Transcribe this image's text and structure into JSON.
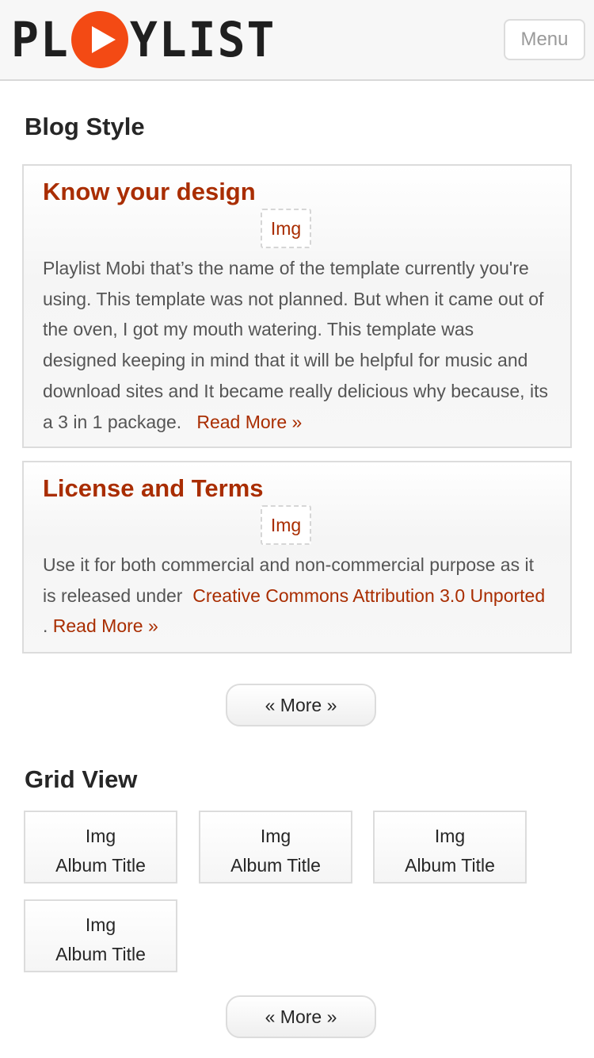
{
  "header": {
    "logo": {
      "left": "PL",
      "right": "YLIST",
      "icon": "play-circle-icon"
    },
    "menu_label": "Menu"
  },
  "colors": {
    "accent": "#a92d00",
    "logo_orange": "#f34a14",
    "text": "#555555",
    "heading": "#262626"
  },
  "blog": {
    "title": "Blog Style",
    "posts": [
      {
        "title": "Know your design",
        "img": "Img",
        "body": "Playlist Mobi that’s the name of the template currently you're using. This template was not planned. But when it came out of the oven, I got my mouth watering. This template was designed keeping in mind that it will be helpful for music and download sites and It became really delicious why because, its a 3 in 1 package.",
        "read_more": "Read More »"
      },
      {
        "title": "License and Terms",
        "img": "Img",
        "body_before": "Use it for both commercial and non-commercial purpose as it is released under",
        "license_link": "Creative Commons Attribution 3.0 Unported",
        "body_after": ".",
        "read_more": "Read More »"
      }
    ],
    "more_label": "« More »"
  },
  "grid": {
    "title": "Grid View",
    "items": [
      {
        "img": "Img",
        "title": "Album Title"
      },
      {
        "img": "Img",
        "title": "Album Title"
      },
      {
        "img": "Img",
        "title": "Album Title"
      },
      {
        "img": "Img",
        "title": "Album Title"
      }
    ],
    "more_label": "« More »"
  }
}
